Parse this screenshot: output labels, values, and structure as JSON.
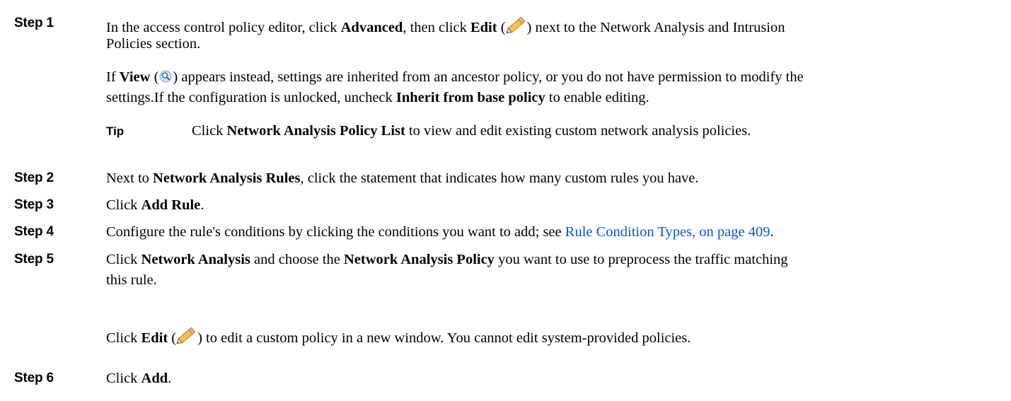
{
  "steps": {
    "s1": {
      "label": "Step 1",
      "l1_a": "In the access control policy editor, click ",
      "l1_advanced": "Advanced",
      "l1_b": ", then click ",
      "l1_edit": "Edit",
      "l1_c": " (",
      "l1_d": ") next to the Network Analysis and Intrusion",
      "l2": "Policies section.",
      "p2_l1_view": "View",
      "p2_l1_a": " (",
      "p2_l1_b": ") appears instead, settings are inherited from an ancestor policy, or you do not have permission to modify the",
      "p2_l1_if": "If ",
      "p2_l2_a": "settings.If the configuration is unlocked, uncheck ",
      "p2_l2_inherit": "Inherit from base policy",
      "p2_l2_b": " to enable editing.",
      "tip_label": "Tip",
      "tip_a": "Click ",
      "tip_list": "Network Analysis Policy List",
      "tip_b": " to view and edit existing custom network analysis policies."
    },
    "s2": {
      "label": "Step 2",
      "a": "Next to ",
      "rules": "Network Analysis Rules",
      "b": ", click the statement that indicates how many custom rules you have."
    },
    "s3": {
      "label": "Step 3",
      "a": "Click ",
      "add_rule": "Add Rule",
      "b": "."
    },
    "s4": {
      "label": "Step 4",
      "a": "Configure the rule's conditions by clicking the conditions you want to add; see ",
      "link": "Rule Condition Types, on page 409",
      "b": "."
    },
    "s5": {
      "label": "Step 5",
      "a": "Click  ",
      "na": "Network Analysis",
      "b": " and choose the ",
      "nap": "Network Analysis Policy",
      "c": " you want to use to preprocess the traffic matching",
      "l2": "this rule.",
      "e_a": "Click ",
      "e_edit": "Edit",
      "e_b": " (",
      "e_c": ") to edit a custom policy in a new window. You cannot edit system-provided policies."
    },
    "s6": {
      "label": "Step 6",
      "a": "Click ",
      "add": "Add",
      "b": "."
    }
  },
  "icons": {
    "edit": "pencil-icon",
    "view": "magnifier-icon"
  },
  "colors": {
    "link": "#0b57c9",
    "pencil": "#f2c14e"
  }
}
